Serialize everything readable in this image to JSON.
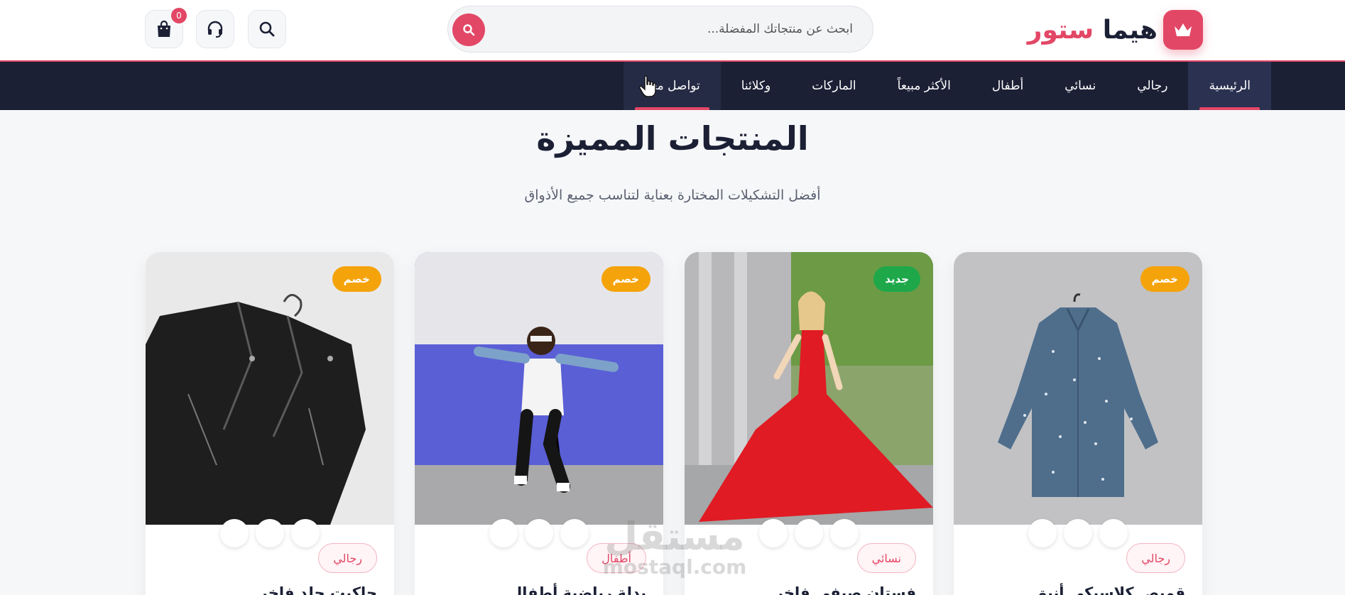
{
  "brand": {
    "name_dark": "هيما",
    "name_accent": "ستور",
    "accent": "#e34766",
    "dark": "#1b2035"
  },
  "search": {
    "placeholder": "ابحث عن منتجاتك المفضلة..."
  },
  "header_icons": {
    "search": "search-icon",
    "support": "headset-icon",
    "cart": "shopping-bag-icon",
    "cart_count": "0"
  },
  "nav": {
    "items": [
      "الرئيسية",
      "رجالي",
      "نسائي",
      "أطفال",
      "الأكثر مبيعاً",
      "الماركات",
      "وكلائنا",
      "تواصل معنا"
    ],
    "active": "الرئيسية"
  },
  "section": {
    "title": "المنتجات المميزة",
    "subtitle": "أفضل التشكيلات المختارة بعناية لتناسب جميع الأذواق"
  },
  "products": [
    {
      "badge": "خصم",
      "badge_color": "#f5a30a",
      "category": "رجالي",
      "title": "قميص كلاسيكي أنيق"
    },
    {
      "badge": "جديد",
      "badge_color": "#1ea84a",
      "category": "نسائي",
      "title": "فستان صيفي فاخر"
    },
    {
      "badge": "خصم",
      "badge_color": "#f5a30a",
      "category": "أطفال",
      "title": "بدلة رياضية أطفال"
    },
    {
      "badge": "خصم",
      "badge_color": "#f5a30a",
      "category": "رجالي",
      "title": "جاكيت جلد فاخر"
    }
  ],
  "watermark": {
    "ar": "مستقل",
    "en": "mostaql.com"
  }
}
